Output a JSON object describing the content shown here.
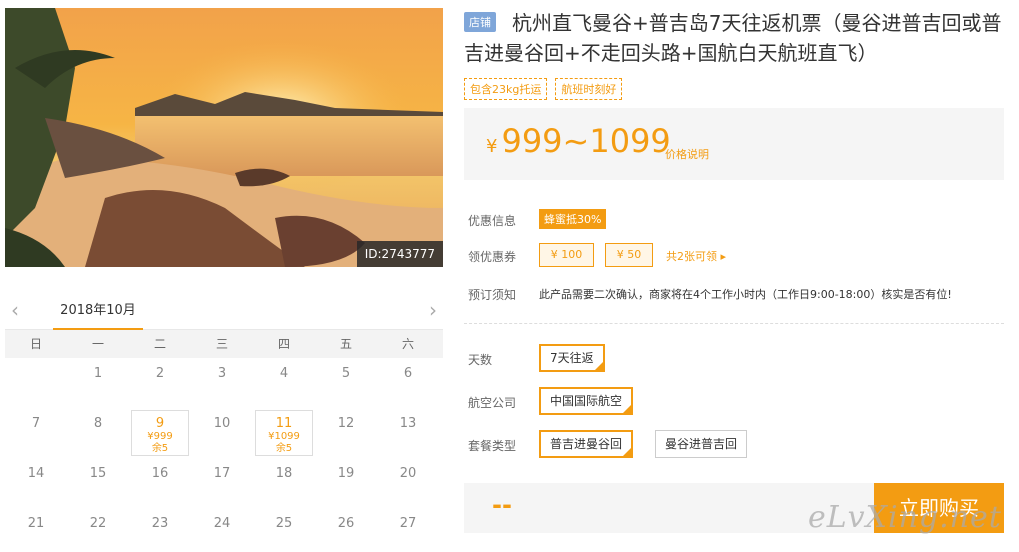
{
  "photo": {
    "id_label": "ID:2743777"
  },
  "calendar": {
    "month": "2018年10月",
    "prev_icon": "‹",
    "next_icon": "›",
    "weekdays": [
      "日",
      "一",
      "二",
      "三",
      "四",
      "五",
      "六"
    ],
    "weeks": [
      [
        {
          "d": ""
        },
        {
          "d": "1"
        },
        {
          "d": "2"
        },
        {
          "d": "3"
        },
        {
          "d": "4"
        },
        {
          "d": "5"
        },
        {
          "d": "6"
        }
      ],
      [
        {
          "d": "7"
        },
        {
          "d": "8"
        },
        {
          "d": "9",
          "price": "¥999",
          "remain": "余5"
        },
        {
          "d": "10"
        },
        {
          "d": "11",
          "price": "¥1099",
          "remain": "余5"
        },
        {
          "d": "12"
        },
        {
          "d": "13"
        }
      ],
      [
        {
          "d": "14"
        },
        {
          "d": "15"
        },
        {
          "d": "16"
        },
        {
          "d": "17"
        },
        {
          "d": "18"
        },
        {
          "d": "19"
        },
        {
          "d": "20"
        }
      ],
      [
        {
          "d": "21"
        },
        {
          "d": "22"
        },
        {
          "d": "23"
        },
        {
          "d": "24"
        },
        {
          "d": "25"
        },
        {
          "d": "26"
        },
        {
          "d": "27"
        }
      ]
    ]
  },
  "product": {
    "shop_tag": "店铺",
    "title": "杭州直飞曼谷+普吉岛7天往返机票（曼谷进普吉回或普吉进曼谷回+不走回头路+国航白天航班直飞）",
    "tags": [
      "包含23kg托运",
      "航班时刻好"
    ],
    "price_currency": "¥",
    "price_range": "999~1099",
    "price_note": "价格说明"
  },
  "info": {
    "promo_label": "优惠信息",
    "promo_badge": "蜂蜜抵30%",
    "coupon_label": "领优惠券",
    "coupons": [
      "¥ 100",
      "¥ 50"
    ],
    "coupon_more": "共2张可领 ▸",
    "notice_label": "预订须知",
    "notice_text": "此产品需要二次确认，商家将在4个工作小时内（工作日9:00-18:00）核实是否有位!"
  },
  "options": {
    "days_label": "天数",
    "days_value": "7天往返",
    "airline_label": "航空公司",
    "airline_value": "中国国际航空",
    "package_label": "套餐类型",
    "package_values": [
      "普吉进曼谷回",
      "曼谷进普吉回"
    ]
  },
  "purchase": {
    "total": "--",
    "buy_label": "立即购买",
    "watermark": "eLvXing.net"
  },
  "colors": {
    "accent": "#f39c12",
    "shop_tag": "#7fa6d9"
  }
}
